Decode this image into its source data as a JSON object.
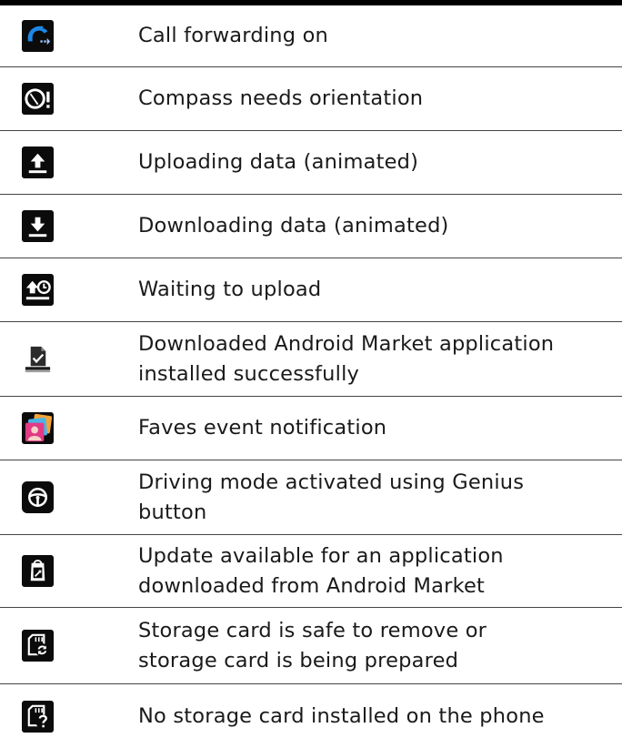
{
  "rows": [
    {
      "icon": "call-forwarding-icon",
      "text": "Call forwarding on"
    },
    {
      "icon": "compass-warning-icon",
      "text": "Compass needs orientation"
    },
    {
      "icon": "upload-icon",
      "text": "Uploading data (animated)"
    },
    {
      "icon": "download-icon",
      "text": "Downloading data (animated)"
    },
    {
      "icon": "upload-waiting-icon",
      "text": "Waiting to upload"
    },
    {
      "icon": "market-installed-icon",
      "text": "Downloaded Android Market application\ninstalled successfully"
    },
    {
      "icon": "faves-icon",
      "text": "Faves event notification"
    },
    {
      "icon": "steering-wheel-icon",
      "text": "Driving mode activated using Genius\nbutton"
    },
    {
      "icon": "market-update-icon",
      "text": "Update available for an application\ndownloaded from Android Market"
    },
    {
      "icon": "sd-card-sync-icon",
      "text": "Storage card is safe to remove or\nstorage card is being prepared"
    },
    {
      "icon": "sd-card-missing-icon",
      "text": "No storage card installed on the phone"
    }
  ]
}
